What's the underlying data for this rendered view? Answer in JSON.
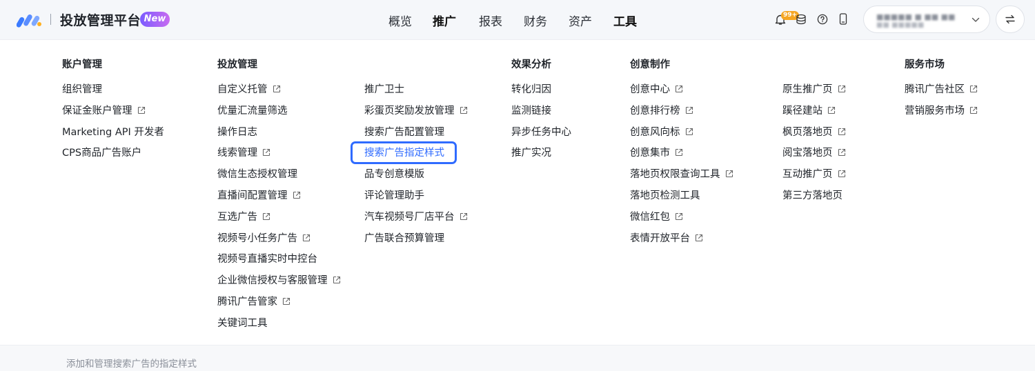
{
  "header": {
    "brand": "投放管理平台",
    "badge": "New",
    "nav": [
      "概览",
      "推广",
      "报表",
      "财务",
      "资产",
      "工具"
    ],
    "notifications_count": "99+",
    "account_line1": "■■■■■ ■ ■■ ■■",
    "account_line2": "■■ ■■■■■"
  },
  "menu": {
    "col_account": {
      "title": "账户管理",
      "items": [
        "组织管理",
        "保证金账户管理",
        "Marketing API 开发者",
        "CPS商品广告账户"
      ]
    },
    "col_delivery": {
      "title": "投放管理",
      "items_a": [
        "自定义托管",
        "优量汇流量筛选",
        "操作日志",
        "线索管理",
        "微信生态授权管理",
        "直播间配置管理",
        "互选广告",
        "视频号小任务广告",
        "视频号直播实时中控台",
        "企业微信授权与客服管理",
        "腾讯广告管家",
        "关键词工具"
      ],
      "items_b": [
        "推广卫士",
        "彩蛋页奖励发放管理",
        "搜索广告配置管理",
        "搜索广告指定样式",
        "品专创意模版",
        "评论管理助手",
        "汽车视频号厂店平台",
        "广告联合预算管理"
      ]
    },
    "col_analysis": {
      "title": "效果分析",
      "items": [
        "转化归因",
        "监测链接",
        "异步任务中心",
        "推广实况"
      ]
    },
    "col_creative": {
      "title": "创意制作",
      "items_a": [
        "创意中心",
        "创意排行榜",
        "创意风向标",
        "创意集市",
        "落地页权限查询工具",
        "落地页检测工具",
        "微信红包",
        "表情开放平台"
      ],
      "items_b": [
        "原生推广页",
        "蹊径建站",
        "枫页落地页",
        "阅宝落地页",
        "互动推广页",
        "第三方落地页"
      ]
    },
    "col_market": {
      "title": "服务市场",
      "items": [
        "腾讯广告社区",
        "营销服务市场"
      ]
    }
  },
  "footer": {
    "hint": "添加和管理搜索广告的指定样式"
  },
  "colors": {
    "accent": "#2f6bff",
    "badge_gradient_start": "#7b5cff",
    "badge_gradient_end": "#c86cf0",
    "notification": "#f5a623"
  }
}
